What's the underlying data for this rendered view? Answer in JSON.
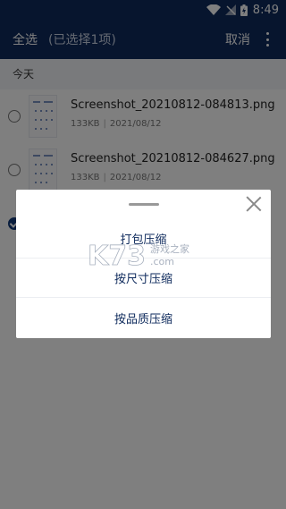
{
  "status_bar": {
    "time": "8:49"
  },
  "action_bar": {
    "select_all": "全选",
    "selected_count": "(已选择1项)",
    "cancel": "取消"
  },
  "section": {
    "header": "今天"
  },
  "files": [
    {
      "name": "Screenshot_20210812-084813.png",
      "size": "133KB",
      "date": "2021/08/12",
      "checked": false
    },
    {
      "name": "Screenshot_20210812-084627.png",
      "size": "133KB",
      "date": "2021/08/12",
      "checked": false
    },
    {
      "name": "",
      "size": "",
      "date": "",
      "checked": true
    }
  ],
  "dialog": {
    "options": [
      "打包压缩",
      "按尺寸压缩",
      "按品质压缩"
    ]
  },
  "watermark": {
    "text": "K73",
    "subtext": "游戏之家",
    "domain": ".com"
  },
  "colors": {
    "primary": "#0e2a5c",
    "accent": "#123a7a"
  }
}
